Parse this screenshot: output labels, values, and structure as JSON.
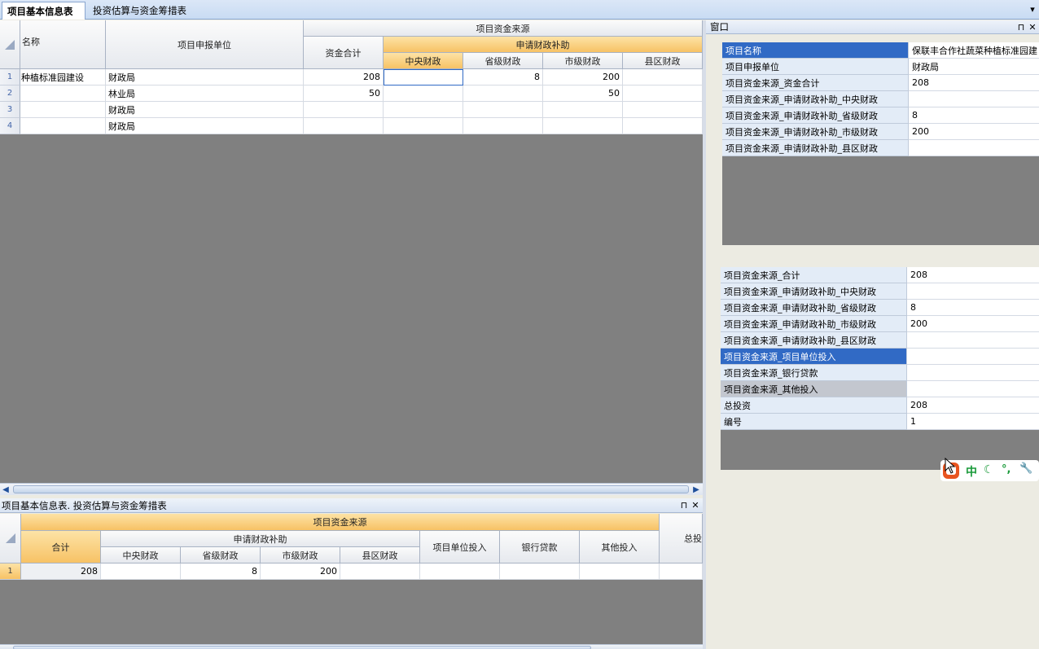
{
  "tabs": {
    "tab1": "项目基本信息表",
    "tab2": "投资估算与资金筹措表",
    "dropdown": "▾"
  },
  "main_grid": {
    "headers": {
      "name": "名称",
      "unit": "项目申报单位",
      "source_group": "项目资金来源",
      "total": "资金合计",
      "subsidy_group": "申请财政补助",
      "central": "中央财政",
      "province": "省级财政",
      "city": "市级财政",
      "county": "县区财政"
    },
    "rows": [
      {
        "n": "1",
        "name": "种植标准园建设",
        "unit": "财政局",
        "total": "208",
        "central": "",
        "province": "8",
        "city": "200",
        "county": ""
      },
      {
        "n": "2",
        "name": "",
        "unit": "林业局",
        "total": "50",
        "central": "",
        "province": "",
        "city": "50",
        "county": ""
      },
      {
        "n": "3",
        "name": "",
        "unit": "财政局",
        "total": "",
        "central": "",
        "province": "",
        "city": "",
        "county": ""
      },
      {
        "n": "4",
        "name": "",
        "unit": "财政局",
        "total": "",
        "central": "",
        "province": "",
        "city": "",
        "county": ""
      }
    ]
  },
  "bottom_panel": {
    "title": "项目基本信息表. 投资估算与资金筹措表",
    "pin": "⊓",
    "close": "✕",
    "headers": {
      "source_group": "项目资金来源",
      "sum": "合计",
      "subsidy_group": "申请财政补助",
      "central": "中央财政",
      "province": "省级财政",
      "city": "市级财政",
      "county": "县区财政",
      "unit_invest": "项目单位投入",
      "bank": "银行贷款",
      "other": "其他投入",
      "total_invest": "总投"
    },
    "rows": [
      {
        "n": "1",
        "sum": "208",
        "central": "",
        "province": "8",
        "city": "200",
        "county": "",
        "unit_invest": "",
        "bank": "",
        "other": "",
        "total_invest": ""
      }
    ]
  },
  "right_panel": {
    "title": "窗口",
    "pin": "⊓",
    "close": "✕",
    "props1": [
      {
        "k": "项目名称",
        "v": "保联丰合作社蔬菜种植标准园建"
      },
      {
        "k": "项目申报单位",
        "v": "财政局"
      },
      {
        "k": "项目资金来源_资金合计",
        "v": "208"
      },
      {
        "k": "项目资金来源_申请财政补助_中央财政",
        "v": ""
      },
      {
        "k": "项目资金来源_申请财政补助_省级财政",
        "v": "8"
      },
      {
        "k": "项目资金来源_申请财政补助_市级财政",
        "v": "200"
      },
      {
        "k": "项目资金来源_申请财政补助_县区财政",
        "v": ""
      }
    ],
    "props2": [
      {
        "k": "项目资金来源_合计",
        "v": "208"
      },
      {
        "k": "项目资金来源_申请财政补助_中央财政",
        "v": ""
      },
      {
        "k": "项目资金来源_申请财政补助_省级财政",
        "v": "8"
      },
      {
        "k": "项目资金来源_申请财政补助_市级财政",
        "v": "200"
      },
      {
        "k": "项目资金来源_申请财政补助_县区财政",
        "v": ""
      },
      {
        "k": "项目资金来源_项目单位投入",
        "v": ""
      },
      {
        "k": "项目资金来源_银行贷款",
        "v": ""
      },
      {
        "k": "项目资金来源_其他投入",
        "v": ""
      },
      {
        "k": "总投资",
        "v": "208"
      },
      {
        "k": "编号",
        "v": "1"
      }
    ]
  },
  "ime_toolbar": {
    "mode": "中",
    "moon": "☾",
    "punct": "°,",
    "tool": "🔧"
  },
  "colors": {
    "selection": "#316ac5",
    "header_orange": "#f7c265",
    "gray_area": "#808080"
  }
}
